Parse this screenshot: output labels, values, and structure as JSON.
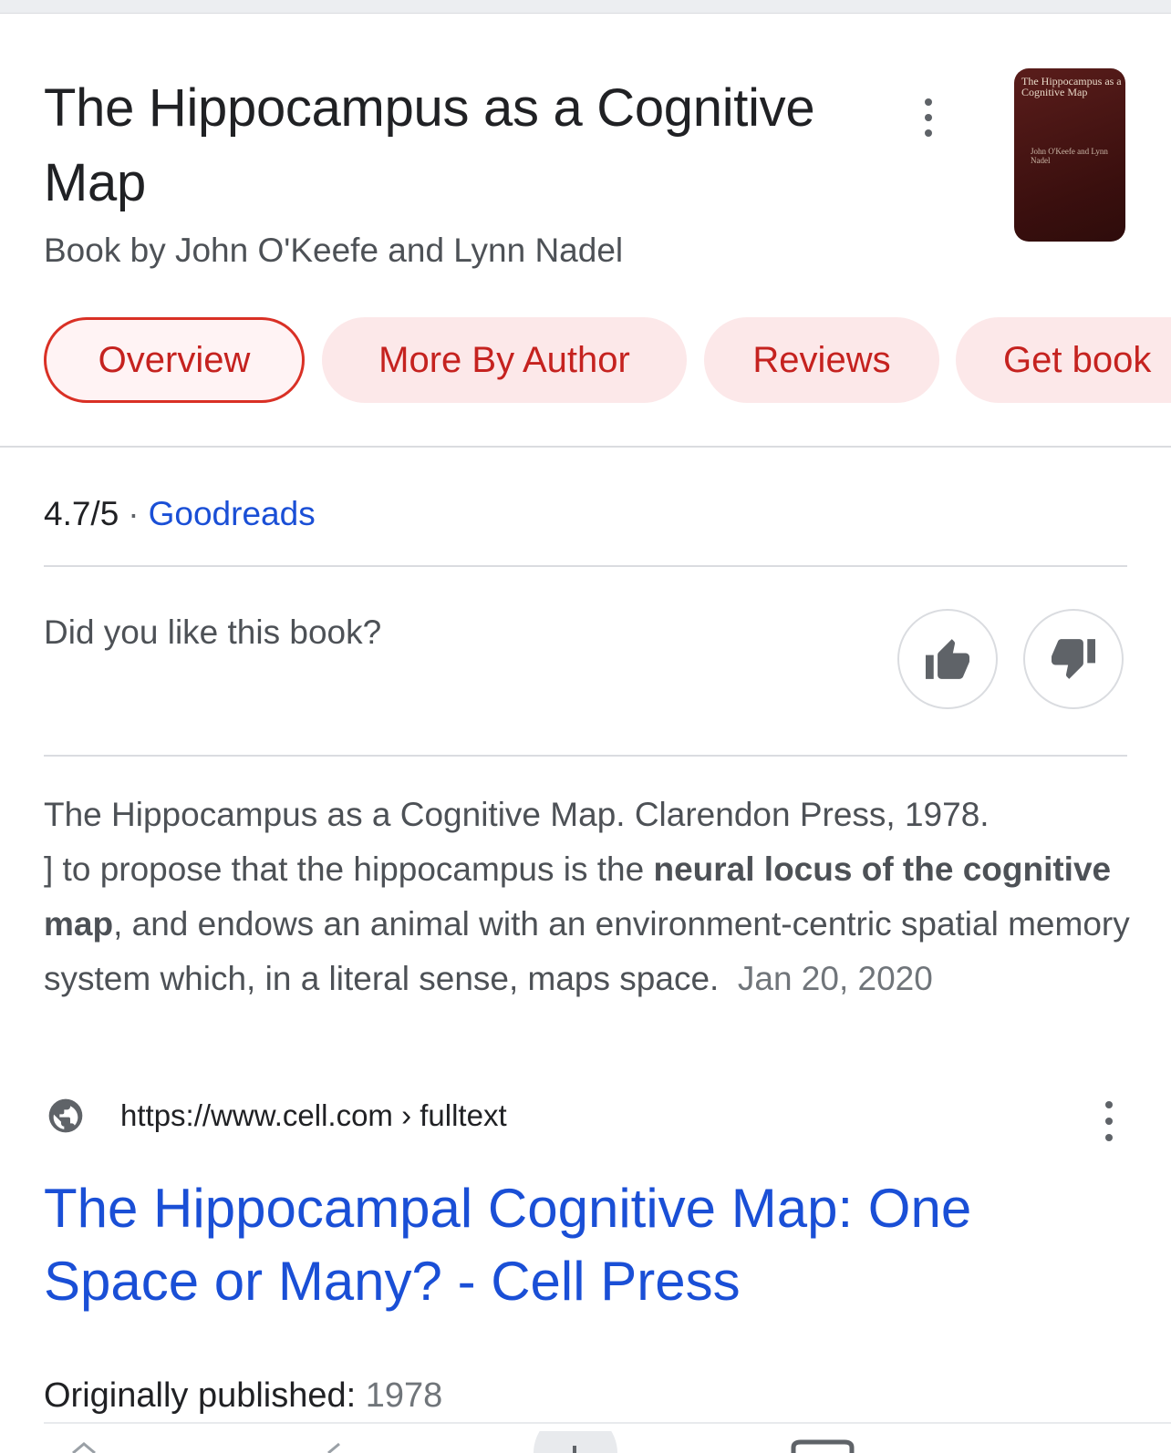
{
  "book": {
    "title": "The Hippocampus as a Cognitive Map",
    "subtitle": "Book by John O'Keefe and Lynn Nadel",
    "cover_text": "The Hippocampus as a Cognitive Map",
    "cover_authors": "John O'Keefe and Lynn Nadel"
  },
  "chips": [
    {
      "label": "Overview"
    },
    {
      "label": "More By Author"
    },
    {
      "label": "Reviews"
    },
    {
      "label": "Get book"
    }
  ],
  "rating": {
    "score": "4.7/5",
    "separator": "·",
    "source": "Goodreads"
  },
  "feedback": {
    "question": "Did you like this book?"
  },
  "snippet": {
    "line1": "The Hippocampus as a Cognitive Map. Clarendon Press, 1978.",
    "part2": "] to propose that the hippocampus is the ",
    "bold": "neural locus of the cognitive map",
    "part3": ", and endows an animal with an environment-centric spatial memory system which, in a literal sense, maps space.",
    "date": "Jan 20, 2020"
  },
  "result": {
    "url": "https://www.cell.com",
    "path": " › fulltext",
    "title": "The Hippocampal Cognitive Map: One Space or Many? - Cell Press"
  },
  "published": {
    "label": "Originally published:",
    "value": "1978"
  },
  "colors": {
    "chip_text": "#c5221f",
    "chip_bg": "#fce8e9",
    "link": "#1a4fd6"
  }
}
